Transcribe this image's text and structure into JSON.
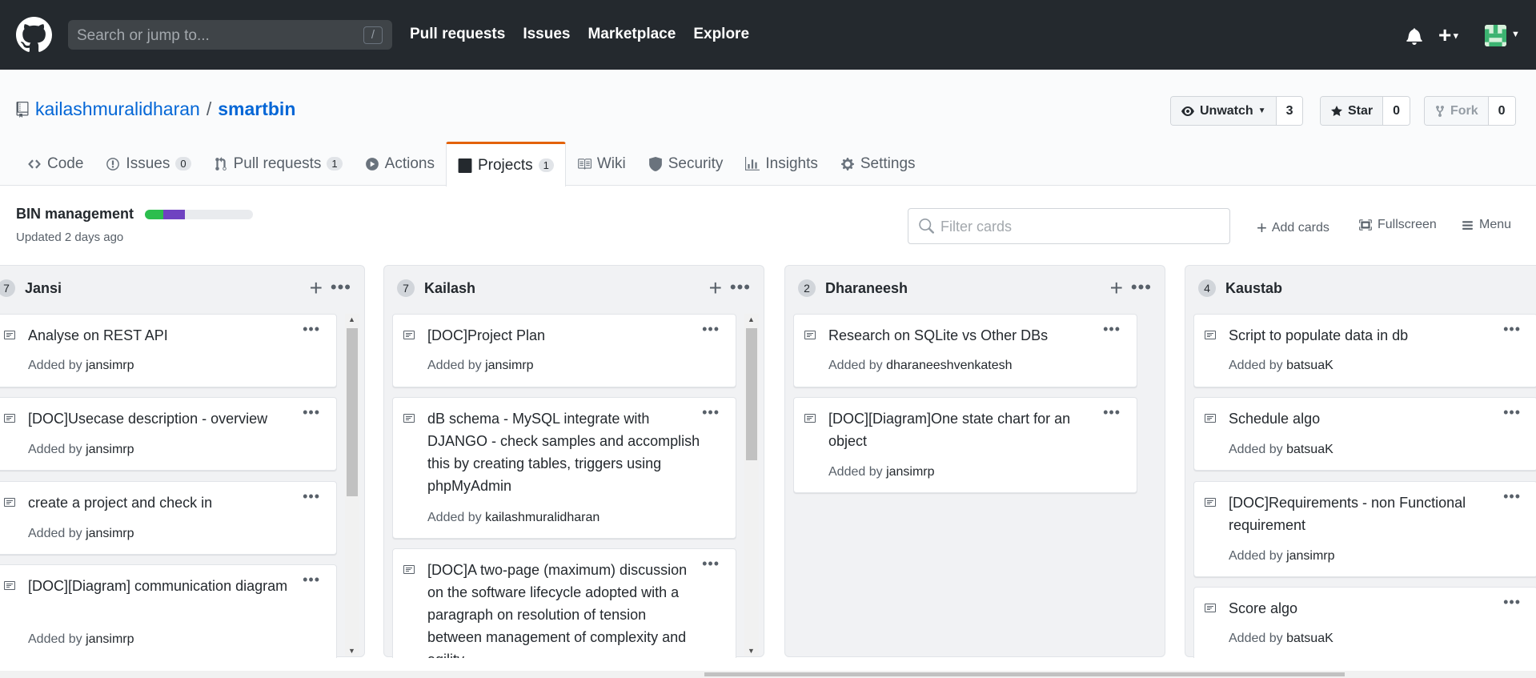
{
  "header": {
    "search_placeholder": "Search or jump to...",
    "search_shortcut": "/",
    "nav": [
      "Pull requests",
      "Issues",
      "Marketplace",
      "Explore"
    ]
  },
  "repo": {
    "owner": "kailashmuralidharan",
    "separator": "/",
    "name": "smartbin",
    "unwatch_label": "Unwatch",
    "watch_count": "3",
    "star_label": "Star",
    "star_count": "0",
    "fork_label": "Fork",
    "fork_count": "0"
  },
  "tabs": [
    {
      "label": "Code"
    },
    {
      "label": "Issues",
      "count": "0"
    },
    {
      "label": "Pull requests",
      "count": "1"
    },
    {
      "label": "Actions"
    },
    {
      "label": "Projects",
      "count": "1"
    },
    {
      "label": "Wiki"
    },
    {
      "label": "Security"
    },
    {
      "label": "Insights"
    },
    {
      "label": "Settings"
    }
  ],
  "project": {
    "name": "BIN management",
    "updated": "Updated 2 days ago",
    "progress_done": 0.17,
    "progress_in_progress": 0.2,
    "filter_placeholder": "Filter cards",
    "add_cards": "Add cards",
    "fullscreen": "Fullscreen",
    "menu": "Menu"
  },
  "added_by_prefix": "Added by",
  "columns": [
    {
      "count": "7",
      "name": "Jansi",
      "cards": [
        {
          "title": "Analyse on REST API",
          "by": "jansimrp"
        },
        {
          "title": "[DOC]Usecase description - overview",
          "by": "jansimrp"
        },
        {
          "title": "create a project and check in",
          "by": "jansimrp"
        },
        {
          "title": "[DOC][Diagram] communication diagram",
          "by": "jansimrp"
        }
      ]
    },
    {
      "count": "7",
      "name": "Kailash",
      "cards": [
        {
          "title": "[DOC]Project Plan",
          "by": "jansimrp"
        },
        {
          "title": "dB schema - MySQL integrate with DJANGO - check samples and accomplish this by creating tables, triggers using phpMyAdmin",
          "by": "kailashmuralidharan"
        },
        {
          "title": "[DOC]A two-page (maximum) discussion on the software lifecycle adopted with a paragraph on resolution of tension between management of complexity and agility",
          "by": ""
        }
      ]
    },
    {
      "count": "2",
      "name": "Dharaneesh",
      "cards": [
        {
          "title": "Research on SQLite vs Other DBs",
          "by": "dharaneeshvenkatesh"
        },
        {
          "title": "[DOC][Diagram]One state chart for an object",
          "by": "jansimrp"
        }
      ]
    },
    {
      "count": "4",
      "name": "Kaustab",
      "cards": [
        {
          "title": "Script to populate data in db",
          "by": "batsuaK"
        },
        {
          "title": "Schedule algo",
          "by": "batsuaK"
        },
        {
          "title": "[DOC]Requirements - non Functional requirement",
          "by": "jansimrp"
        },
        {
          "title": "Score algo",
          "by": "batsuaK"
        }
      ]
    }
  ],
  "colors": {
    "header_bg": "#24292e",
    "link": "#0366d6",
    "tab_accent": "#e36209",
    "progress_done": "#2cbe4e",
    "progress_in_progress": "#6f42c1"
  }
}
